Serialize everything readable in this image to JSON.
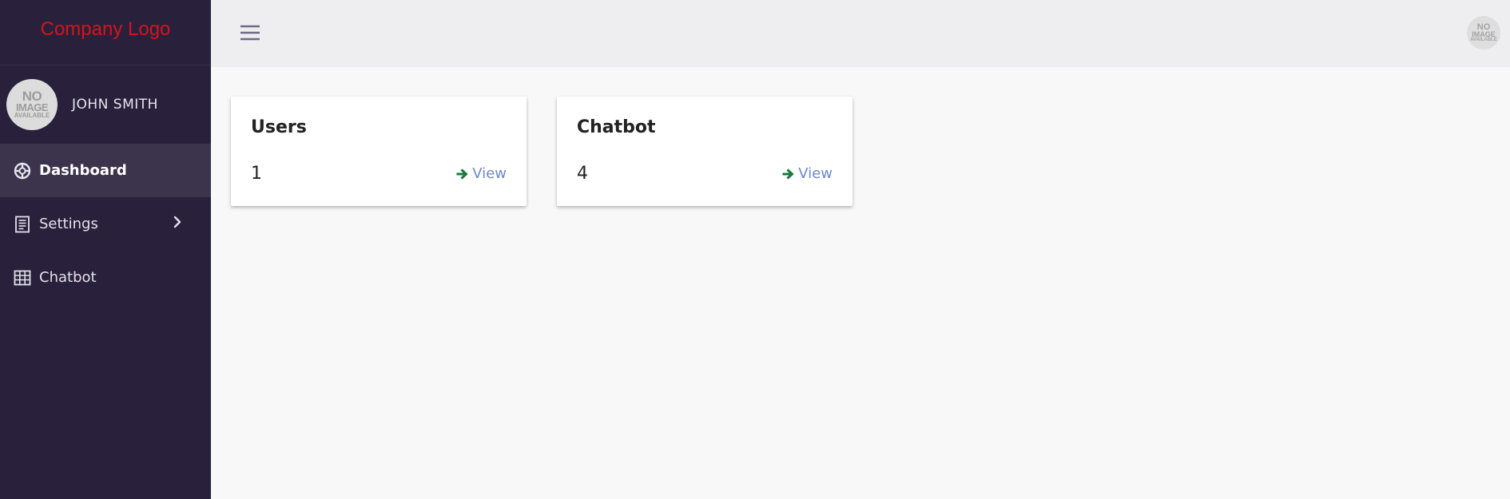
{
  "brand": {
    "logo_text": "Company Logo",
    "color": "#d3141c"
  },
  "profile": {
    "name": "JOHN SMITH",
    "avatar_placeholder": [
      "NO",
      "IMAGE",
      "AVAILABLE"
    ]
  },
  "sidebar": {
    "items": [
      {
        "label": "Dashboard",
        "icon": "dashboard-icon",
        "active": true
      },
      {
        "label": "Settings",
        "icon": "document-icon",
        "has_submenu": true
      },
      {
        "label": "Chatbot",
        "icon": "grid-icon"
      }
    ]
  },
  "topbar": {
    "menu_icon": "hamburger-icon",
    "avatar_placeholder": [
      "NO",
      "IMAGE",
      "AVAILABLE"
    ]
  },
  "cards": [
    {
      "title": "Users",
      "count": "1",
      "link_label": "View",
      "link_icon": "arrow-right-icon"
    },
    {
      "title": "Chatbot",
      "count": "4",
      "link_label": "View",
      "link_icon": "arrow-right-icon"
    }
  ],
  "colors": {
    "sidebar_bg": "#29213b",
    "sidebar_active_bg": "#3b344c",
    "link": "#6f88c8",
    "link_arrow": "#1a7a3c"
  }
}
